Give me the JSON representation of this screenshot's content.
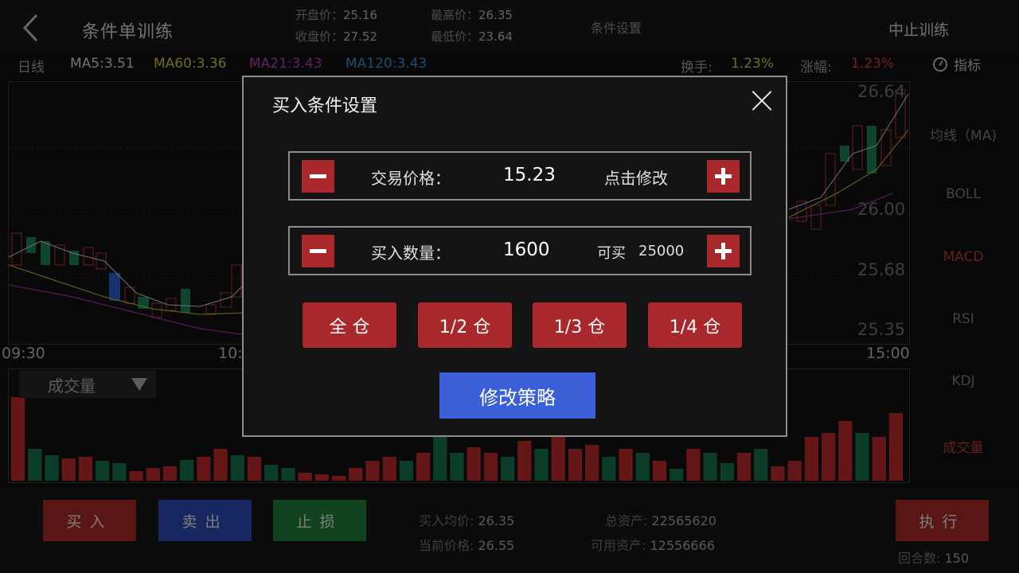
{
  "header": {
    "title": "条件单训练",
    "open_label": "开盘价：",
    "open_value": "25.16",
    "close_label": "收盘价：",
    "close_value": "27.52",
    "high_label": "最高价：",
    "high_value": "26.35",
    "low_label": "最低价：",
    "low_value": "23.64",
    "settings_label": "条件设置",
    "stop_label": "中止训练"
  },
  "ma_row": {
    "period": "日线",
    "ma5": "MA5:3.51",
    "ma60": "MA60:3.36",
    "ma21": "MA21:3.43",
    "ma120": "MA120:3.43",
    "turnover_label": "换手:",
    "turnover_value": "1.23%",
    "change_label": "涨幅:",
    "change_value": "1.23%",
    "indicator_label": "指标",
    "colors": {
      "ma5": "#cfcfcf",
      "ma60": "#c8c43a",
      "ma21": "#b23fb1",
      "ma120": "#2f8fc8"
    }
  },
  "chart": {
    "prices": [
      "26.64",
      "26.00",
      "25.68",
      "25.35"
    ],
    "times": [
      "09:30",
      "10:",
      "15:00"
    ],
    "volume_label": "成交量"
  },
  "right_menu": [
    "均线（MA)",
    "BOLL",
    "MACD",
    "RSI",
    "KDJ",
    "成交量"
  ],
  "bottom": {
    "buy": "买入",
    "sell": "卖出",
    "stop_loss": "止损",
    "avg_buy_label": "买入均价:",
    "avg_buy_value": "26.35",
    "current_label": "当前价格:",
    "current_value": "26.55",
    "total_label": "总资产:",
    "total_value": "22565620",
    "avail_label": "可用资产:",
    "avail_value": "12556666",
    "execute": "执行",
    "rounds_label": "回合数:",
    "rounds_value": "150"
  },
  "dialog": {
    "title": "买入条件设置",
    "price_label": "交易价格：",
    "price_value": "15.23",
    "price_edit": "点击修改",
    "qty_label": "买入数量：",
    "qty_value": "1600",
    "can_buy_label": "可买",
    "can_buy_value": "25000",
    "full": "全 仓",
    "half": "1/2 仓",
    "third": "1/3 仓",
    "quarter": "1/4 仓",
    "modify": "修改策略"
  }
}
